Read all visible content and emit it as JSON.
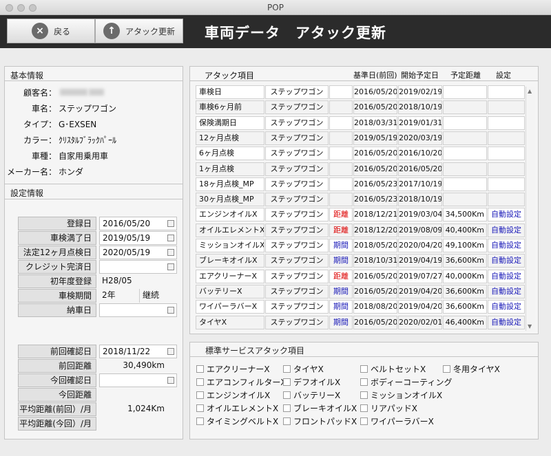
{
  "window_title": "POP",
  "toolbar": {
    "back_label": "戻る",
    "attack_update_label": "アタック更新"
  },
  "page_title": "車両データ　アタック更新",
  "basic_info": {
    "section_title": "基本情報",
    "fields": [
      {
        "label": "顧客名：",
        "value": ""
      },
      {
        "label": "車名：",
        "value": "ステップワゴン"
      },
      {
        "label": "タイプ：",
        "value": "G･EXSEN"
      },
      {
        "label": "カラー：",
        "value": "ｸﾘｽﾀﾙﾌﾞﾗｯｸﾊﾟｰﾙ"
      },
      {
        "label": "車種：",
        "value": "自家用乗用車"
      },
      {
        "label": "メーカー名：",
        "value": "ホンダ"
      }
    ]
  },
  "settings": {
    "section_title": "設定情報",
    "registration_date": {
      "label": "登録日",
      "value": "2016/05/20"
    },
    "inspection_expiry": {
      "label": "車検満了日",
      "value": "2019/05/19"
    },
    "legal_12m_inspection": {
      "label": "法定12ヶ月点検日",
      "value": "2020/05/19"
    },
    "credit_completion": {
      "label": "クレジット完済日",
      "value": ""
    },
    "first_year_registration": {
      "label": "初年度登録",
      "value": "H28/05"
    },
    "inspection_period": {
      "label": "車検期間",
      "value": "2年",
      "value2": "継続"
    },
    "delivery_date": {
      "label": "納車日",
      "value": ""
    },
    "last_check_date": {
      "label": "前回確認日",
      "value": "2018/11/22"
    },
    "last_distance": {
      "label": "前回距離",
      "value": "30,490km"
    },
    "this_check_date": {
      "label": "今回確認日",
      "value": ""
    },
    "this_distance": {
      "label": "今回距離",
      "value": ""
    },
    "avg_distance_last": {
      "label": "平均距離(前回）/月",
      "value": "1,024Km"
    },
    "avg_distance_this": {
      "label": "平均距離(今回）/月",
      "value": ""
    }
  },
  "attack_table": {
    "columns": [
      "アタック項目",
      "基準日(前回)",
      "開始予定日",
      "予定距離",
      "設定"
    ],
    "rows": [
      {
        "item": "車検日",
        "car": "ステップワゴン",
        "type": "",
        "base": "2016/05/20",
        "start": "2019/02/19",
        "dist": "",
        "setting": ""
      },
      {
        "item": "車検6ヶ月前",
        "car": "ステップワゴン",
        "type": "",
        "base": "2016/05/20",
        "start": "2018/10/19",
        "dist": "",
        "setting": ""
      },
      {
        "item": "保険満期日",
        "car": "ステップワゴン",
        "type": "",
        "base": "2018/03/31",
        "start": "2019/01/31",
        "dist": "",
        "setting": ""
      },
      {
        "item": "12ヶ月点検",
        "car": "ステップワゴン",
        "type": "",
        "base": "2019/05/19",
        "start": "2020/03/19",
        "dist": "",
        "setting": ""
      },
      {
        "item": "6ヶ月点検",
        "car": "ステップワゴン",
        "type": "",
        "base": "2016/05/20",
        "start": "2016/10/20",
        "dist": "",
        "setting": ""
      },
      {
        "item": "1ヶ月点検",
        "car": "ステップワゴン",
        "type": "",
        "base": "2016/05/20",
        "start": "2016/05/20",
        "dist": "",
        "setting": ""
      },
      {
        "item": "18ヶ月点検_MP",
        "car": "ステップワゴン",
        "type": "",
        "base": "2016/05/23",
        "start": "2017/10/19",
        "dist": "",
        "setting": ""
      },
      {
        "item": "30ヶ月点検_MP",
        "car": "ステップワゴン",
        "type": "",
        "base": "2016/05/23",
        "start": "2018/10/19",
        "dist": "",
        "setting": ""
      },
      {
        "item": "エンジンオイルX",
        "car": "ステップワゴン",
        "type": "距離",
        "base": "2018/12/21",
        "start": "2019/03/04",
        "dist": "34,500Km",
        "setting": "自動設定"
      },
      {
        "item": "オイルエレメントX",
        "car": "ステップワゴン",
        "type": "距離",
        "base": "2018/12/20",
        "start": "2019/08/09",
        "dist": "40,400Km",
        "setting": "自動設定"
      },
      {
        "item": "ミッションオイルX",
        "car": "ステップワゴン",
        "type": "期間",
        "base": "2018/05/20",
        "start": "2020/04/20",
        "dist": "49,100Km",
        "setting": "自動設定"
      },
      {
        "item": "ブレーキオイルX",
        "car": "ステップワゴン",
        "type": "期間",
        "base": "2018/10/31",
        "start": "2019/04/19",
        "dist": "36,600Km",
        "setting": "自動設定"
      },
      {
        "item": "エアクリーナーX",
        "car": "ステップワゴン",
        "type": "距離",
        "base": "2016/05/20",
        "start": "2019/07/27",
        "dist": "40,000Km",
        "setting": "自動設定"
      },
      {
        "item": "バッテリーX",
        "car": "ステップワゴン",
        "type": "期間",
        "base": "2016/05/20",
        "start": "2019/04/20",
        "dist": "36,600Km",
        "setting": "自動設定"
      },
      {
        "item": "ワイパーラバーX",
        "car": "ステップワゴン",
        "type": "期間",
        "base": "2018/08/20",
        "start": "2019/04/20",
        "dist": "36,600Km",
        "setting": "自動設定"
      },
      {
        "item": "タイヤX",
        "car": "ステップワゴン",
        "type": "期間",
        "base": "2016/05/20",
        "start": "2020/02/01",
        "dist": "46,400Km",
        "setting": "自動設定"
      }
    ]
  },
  "standard_service": {
    "section_title": "標準サービスアタック項目",
    "items": [
      "エアクリーナーX",
      "エアコンフィルターX",
      "エンジンオイルX",
      "オイルエレメントX",
      "タイミングベルトX",
      "タイヤX",
      "デフオイルX",
      "バッテリーX",
      "ブレーキオイルX",
      "フロントパッドX",
      "ベルトセットX",
      "ボディーコーティング",
      "ミッションオイルX",
      "リアパッドX",
      "ワイパーラバーX",
      "冬用タイヤX"
    ]
  },
  "colors": {
    "header_bg": "#2b2b2b",
    "distance_type": "#dd0000",
    "period_type": "#1a1ab8",
    "auto_setting": "#1a1ab8"
  }
}
